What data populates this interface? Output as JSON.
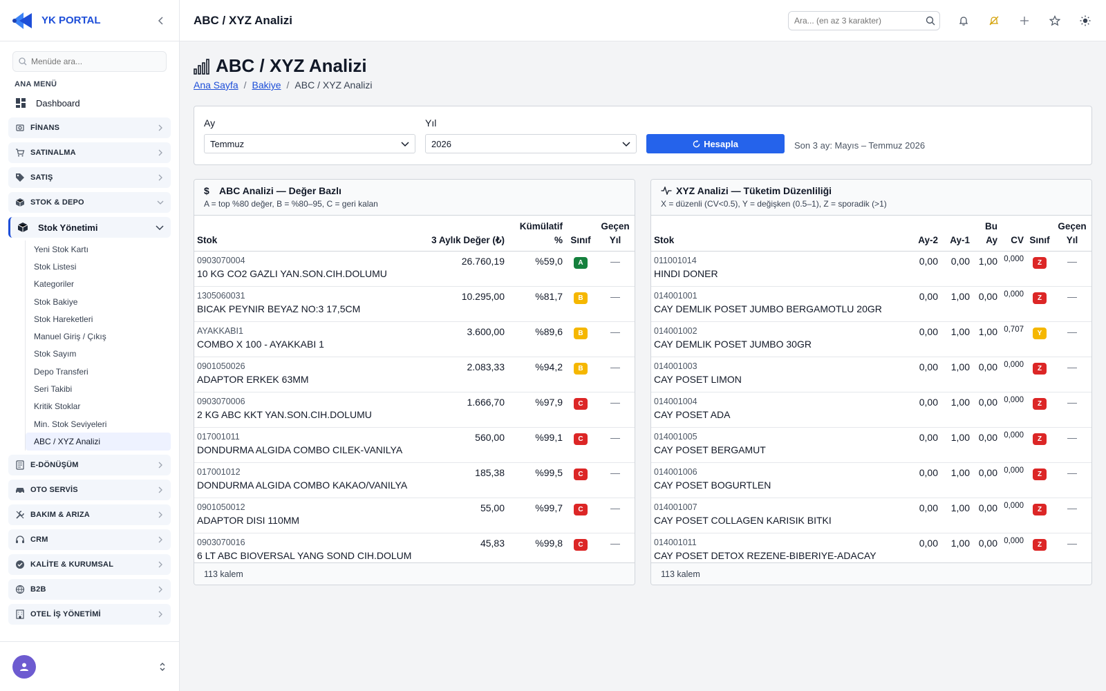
{
  "brand": {
    "name": "YK PORTAL"
  },
  "menu": {
    "search_placeholder": "Menüde ara...",
    "title": "ANA MENÜ",
    "dashboard": "Dashboard",
    "groups_top": [
      {
        "label": "FİNANS",
        "icon": "finance-icon"
      },
      {
        "label": "SATINALMA",
        "icon": "cart-icon"
      },
      {
        "label": "SATIŞ",
        "icon": "tag-icon"
      },
      {
        "label": "STOK & DEPO",
        "icon": "box-icon"
      }
    ],
    "stock_mgmt": {
      "label": "Stok Yönetimi",
      "items": [
        "Yeni Stok Kartı",
        "Stok Listesi",
        "Kategoriler",
        "Stok Bakiye",
        "Stok Hareketleri",
        "Manuel Giriş / Çıkış",
        "Stok Sayım",
        "Depo Transferi",
        "Seri Takibi",
        "Kritik Stoklar",
        "Min. Stok Seviyeleri",
        "ABC / XYZ Analizi"
      ]
    },
    "groups_bottom": [
      {
        "label": "E-DÖNÜŞÜM",
        "icon": "document-icon"
      },
      {
        "label": "OTO SERVİS",
        "icon": "car-icon"
      },
      {
        "label": "BAKIM & ARIZA",
        "icon": "wrench-icon"
      },
      {
        "label": "CRM",
        "icon": "headset-icon"
      },
      {
        "label": "KALİTE & KURUMSAL",
        "icon": "badge-check-icon"
      },
      {
        "label": "B2B",
        "icon": "globe-icon"
      },
      {
        "label": "OTEL İŞ YÖNETİMİ",
        "icon": "building-icon"
      }
    ]
  },
  "topbar": {
    "title": "ABC / XYZ Analizi",
    "search_placeholder": "Ara... (en az 3 karakter)"
  },
  "page": {
    "title": "ABC / XYZ Analizi",
    "breadcrumb": {
      "home": "Ana Sayfa",
      "parent": "Bakiye",
      "current": "ABC / XYZ Analizi"
    }
  },
  "filters": {
    "month_label": "Ay",
    "month_value": "Temmuz",
    "year_label": "Yıl",
    "year_value": "2026",
    "calc_button": "Hesapla",
    "range_note": "Son 3 ay: Mayıs – Temmuz 2026"
  },
  "abc": {
    "title": "ABC Analizi — Değer Bazlı",
    "subtitle": "A = top %80 değer, B = %80–95, C = geri kalan",
    "headers": {
      "stock": "Stok",
      "value": "3 Aylık Değer (₺)",
      "cumulative": "Kümülatif %",
      "class": "Sınıf",
      "last_year": "Geçen Yıl"
    },
    "rows": [
      {
        "code": "0903070004",
        "name": "10 KG CO2 GAZLI YAN.SON.CIH.DOLUMU",
        "value": "26.760,19",
        "cum": "%59,0",
        "class": "A",
        "last": "—"
      },
      {
        "code": "1305060031",
        "name": "BICAK PEYNIR BEYAZ NO:3 17,5CM",
        "value": "10.295,00",
        "cum": "%81,7",
        "class": "B",
        "last": "—"
      },
      {
        "code": "AYAKKABI1",
        "name": "COMBO X 100 - AYAKKABI 1",
        "value": "3.600,00",
        "cum": "%89,6",
        "class": "B",
        "last": "—"
      },
      {
        "code": "0901050026",
        "name": "ADAPTOR ERKEK 63MM",
        "value": "2.083,33",
        "cum": "%94,2",
        "class": "B",
        "last": "—"
      },
      {
        "code": "0903070006",
        "name": "2 KG ABC KKT YAN.SON.CIH.DOLUMU",
        "value": "1.666,70",
        "cum": "%97,9",
        "class": "C",
        "last": "—"
      },
      {
        "code": "017001011",
        "name": "DONDURMA ALGIDA COMBO CILEK-VANILYA",
        "value": "560,00",
        "cum": "%99,1",
        "class": "C",
        "last": "—"
      },
      {
        "code": "017001012",
        "name": "DONDURMA ALGIDA COMBO KAKAO/VANILYA",
        "value": "185,38",
        "cum": "%99,5",
        "class": "C",
        "last": "—"
      },
      {
        "code": "0901050012",
        "name": "ADAPTOR DISI 110MM",
        "value": "55,00",
        "cum": "%99,7",
        "class": "C",
        "last": "—"
      },
      {
        "code": "0903070016",
        "name": "6 LT ABC BIOVERSAL YANG SOND CIH.DOLUM",
        "value": "45,83",
        "cum": "%99,8",
        "class": "C",
        "last": "—"
      }
    ],
    "footer": "113 kalem"
  },
  "xyz": {
    "title": "XYZ Analizi — Tüketim Düzenliliği",
    "subtitle": "X = düzenli (CV<0.5), Y = değişken (0.5–1), Z = sporadik (>1)",
    "headers": {
      "stock": "Stok",
      "m2": "Ay-2",
      "m1": "Ay-1",
      "cur": "Bu Ay",
      "cv": "CV",
      "class": "Sınıf",
      "last_year": "Geçen Yıl"
    },
    "rows": [
      {
        "code": "011001014",
        "name": "HINDI DONER",
        "m2": "0,00",
        "m1": "0,00",
        "cur": "1,00",
        "cv": "0,000",
        "class": "Z",
        "last": "—"
      },
      {
        "code": "014001001",
        "name": "CAY DEMLIK POSET JUMBO BERGAMOTLU 20GR",
        "m2": "0,00",
        "m1": "1,00",
        "cur": "0,00",
        "cv": "0,000",
        "class": "Z",
        "last": "—"
      },
      {
        "code": "014001002",
        "name": "CAY DEMLIK POSET JUMBO 30GR",
        "m2": "0,00",
        "m1": "1,00",
        "cur": "1,00",
        "cv": "0,707",
        "class": "Y",
        "last": "—"
      },
      {
        "code": "014001003",
        "name": "CAY POSET LIMON",
        "m2": "0,00",
        "m1": "1,00",
        "cur": "0,00",
        "cv": "0,000",
        "class": "Z",
        "last": "—"
      },
      {
        "code": "014001004",
        "name": "CAY POSET ADA",
        "m2": "0,00",
        "m1": "1,00",
        "cur": "0,00",
        "cv": "0,000",
        "class": "Z",
        "last": "—"
      },
      {
        "code": "014001005",
        "name": "CAY POSET BERGAMUT",
        "m2": "0,00",
        "m1": "1,00",
        "cur": "0,00",
        "cv": "0,000",
        "class": "Z",
        "last": "—"
      },
      {
        "code": "014001006",
        "name": "CAY POSET BOGURTLEN",
        "m2": "0,00",
        "m1": "1,00",
        "cur": "0,00",
        "cv": "0,000",
        "class": "Z",
        "last": "—"
      },
      {
        "code": "014001007",
        "name": "CAY POSET COLLAGEN KARISIK BITKI",
        "m2": "0,00",
        "m1": "1,00",
        "cur": "0,00",
        "cv": "0,000",
        "class": "Z",
        "last": "—"
      },
      {
        "code": "014001011",
        "name": "CAY POSET DETOX REZENE-BIBERIYE-ADACAY",
        "m2": "0,00",
        "m1": "1,00",
        "cur": "0,00",
        "cv": "0,000",
        "class": "Z",
        "last": "—"
      }
    ],
    "footer": "113 kalem"
  },
  "colors": {
    "accent": "#2563eb",
    "brand": "#1d4ed8",
    "class_a": "#15803d",
    "class_b": "#f5b700",
    "class_c": "#dc2626"
  }
}
